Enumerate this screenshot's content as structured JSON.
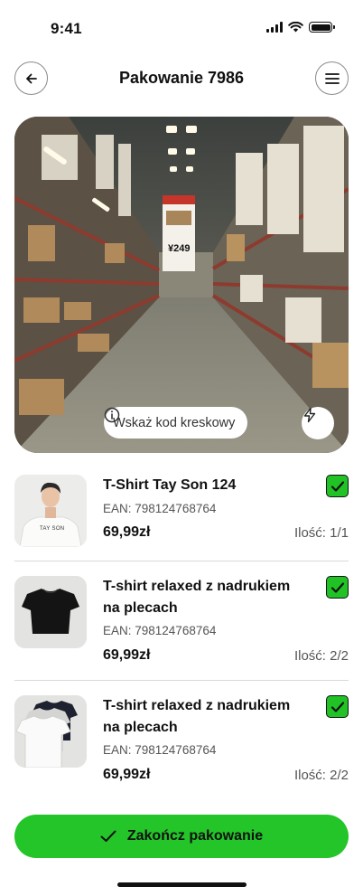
{
  "status_bar": {
    "time": "9:41"
  },
  "header": {
    "title": "Pakowanie 7986",
    "back_icon": "arrow-left-icon",
    "menu_icon": "hamburger-menu-icon"
  },
  "scanner": {
    "hint": "Wskaż kod kreskowy",
    "price_tag": "¥249",
    "hint_icon": "info-icon",
    "flash_icon": "lightning-icon"
  },
  "products": [
    {
      "name": "T-Shirt Tay Son 124",
      "ean": "EAN: 798124768764",
      "price": "69,99zł",
      "quantity": "Ilość: 1/1",
      "checked": true,
      "thumb_logo": "TAY SON"
    },
    {
      "name": "T-shirt relaxed z nadrukiem na plecach",
      "ean": "EAN: 798124768764",
      "price": "69,99zł",
      "quantity": "Ilość: 2/2",
      "checked": true
    },
    {
      "name": "T-shirt relaxed z nadrukiem na plecach",
      "ean": "EAN: 798124768764",
      "price": "69,99zł",
      "quantity": "Ilość: 2/2",
      "checked": true
    }
  ],
  "footer": {
    "finish_label": "Zakończ pakowanie",
    "finish_icon": "checkmark-icon"
  },
  "colors": {
    "accent_green": "#23c529",
    "check_green": "#21c225"
  }
}
